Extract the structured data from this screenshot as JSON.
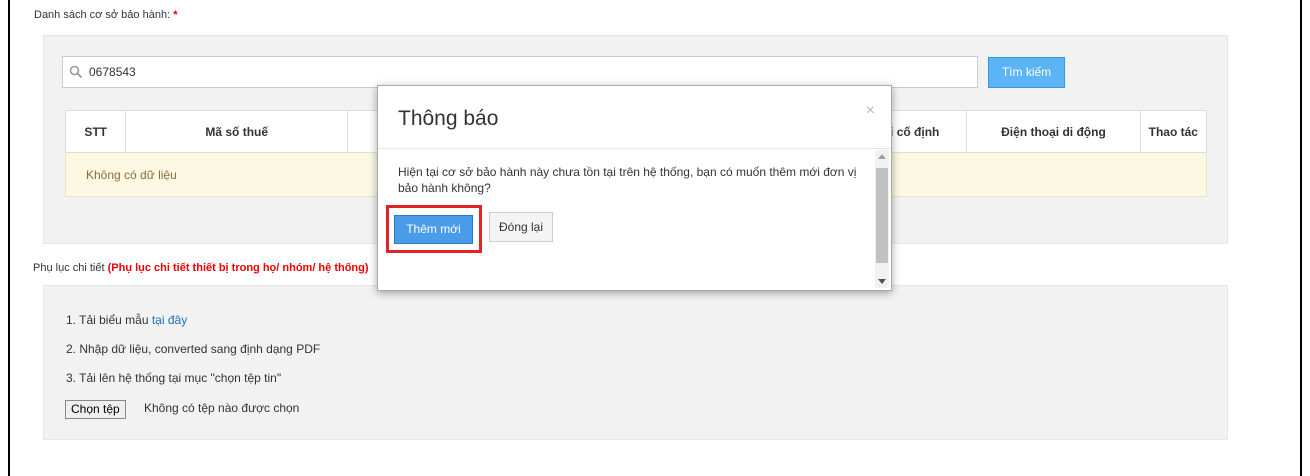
{
  "page": {
    "list_label": "Danh sách cơ sở bảo hành:",
    "required_mark": "*"
  },
  "search": {
    "value": "0678543",
    "button_label": "Tìm kiếm"
  },
  "table": {
    "headers": [
      "STT",
      "Mã số thuế",
      "",
      "ại cố định",
      "Điện thoại di động",
      "Thao tác"
    ],
    "empty_message": "Không có dữ liệu"
  },
  "appendix": {
    "label": "Phụ lục chi tiết",
    "note": "(Phụ lục chi tiết thiết bị trong họ/ nhóm/ hệ thống)"
  },
  "upload": {
    "step1_prefix": "1. Tải biểu mẫu",
    "step1_link": "tại đây",
    "step2": "2. Nhập dữ liệu, converted sang định dạng PDF",
    "step3": "3. Tải lên hệ thống tại mục \"chọn tệp tin\"",
    "choose_file_label": "Chọn tệp",
    "no_file_text": "Không có tệp nào được chọn"
  },
  "modal": {
    "title": "Thông báo",
    "close_symbol": "×",
    "message": "Hiện tại cơ sở bảo hành này chưa tồn tại trên hệ thống, bạn có muốn thêm mới đơn vị bảo hành không?",
    "add_label": "Thêm mới",
    "close_label": "Đóng lại"
  },
  "colors": {
    "primary_button": "#5bb4f5",
    "highlight_border": "#e02424",
    "empty_row_bg": "#fcf8e3",
    "required_red": "#dd0000"
  }
}
